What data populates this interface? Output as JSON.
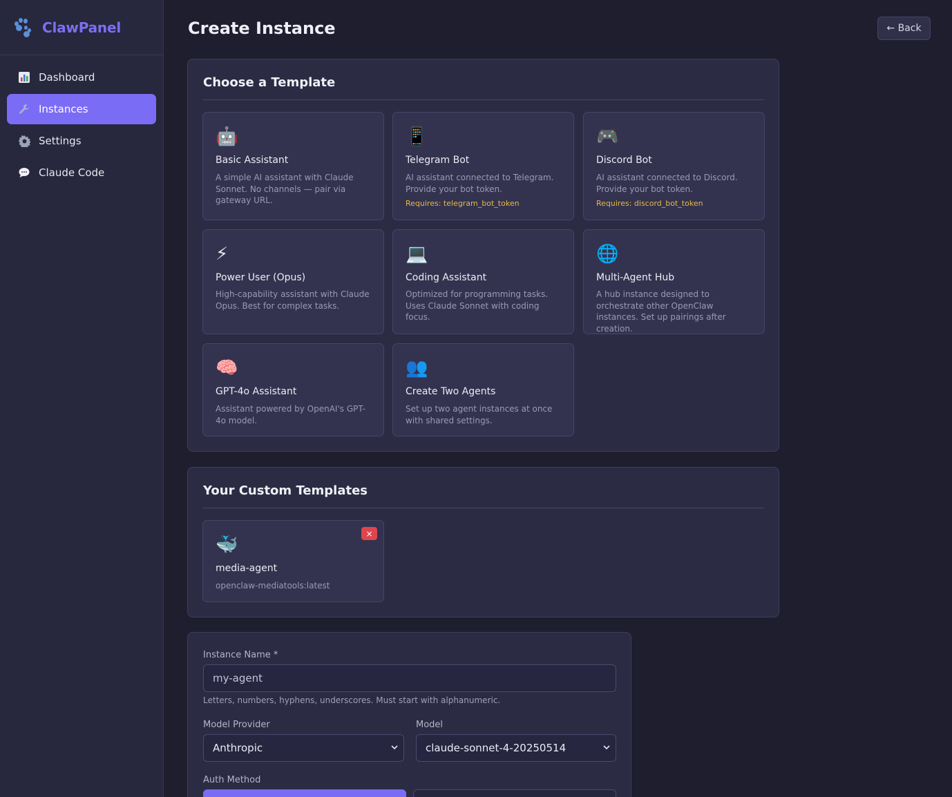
{
  "app": {
    "name": "ClawPanel"
  },
  "sidebar": {
    "items": [
      {
        "label": "Dashboard",
        "icon": "bar-chart-icon",
        "active": false
      },
      {
        "label": "Instances",
        "icon": "wrench-icon",
        "active": true
      },
      {
        "label": "Settings",
        "icon": "gear-icon",
        "active": false
      },
      {
        "label": "Claude Code",
        "icon": "speech-bubble-icon",
        "active": false
      }
    ]
  },
  "header": {
    "title": "Create Instance",
    "back_label": "← Back"
  },
  "templates": {
    "heading": "Choose a Template",
    "cards": [
      {
        "emoji": "🤖",
        "icon": "robot-icon",
        "title": "Basic Assistant",
        "desc": "A simple AI assistant with Claude Sonnet. No channels — pair via gateway URL.",
        "requires": ""
      },
      {
        "emoji": "📱",
        "icon": "phone-icon",
        "title": "Telegram Bot",
        "desc": "AI assistant connected to Telegram. Provide your bot token.",
        "requires": "Requires: telegram_bot_token"
      },
      {
        "emoji": "🎮",
        "icon": "game-controller-icon",
        "title": "Discord Bot",
        "desc": "AI assistant connected to Discord. Provide your bot token.",
        "requires": "Requires: discord_bot_token"
      },
      {
        "emoji": "⚡",
        "icon": "lightning-icon",
        "title": "Power User (Opus)",
        "desc": "High-capability assistant with Claude Opus. Best for complex tasks.",
        "requires": ""
      },
      {
        "emoji": "💻",
        "icon": "laptop-icon",
        "title": "Coding Assistant",
        "desc": "Optimized for programming tasks. Uses Claude Sonnet with coding focus.",
        "requires": ""
      },
      {
        "emoji": "🌐",
        "icon": "globe-icon",
        "title": "Multi-Agent Hub",
        "desc": "A hub instance designed to orchestrate other OpenClaw instances. Set up pairings after creation.",
        "requires": ""
      },
      {
        "emoji": "🧠",
        "icon": "brain-icon",
        "title": "GPT-4o Assistant",
        "desc": "Assistant powered by OpenAI's GPT-4o model.",
        "requires": ""
      },
      {
        "emoji": "👥",
        "icon": "two-people-icon",
        "title": "Create Two Agents",
        "desc": "Set up two agent instances at once with shared settings.",
        "requires": ""
      }
    ]
  },
  "custom_templates": {
    "heading": "Your Custom Templates",
    "cards": [
      {
        "emoji": "🐳",
        "icon": "whale-icon",
        "title": "media-agent",
        "desc": "openclaw-mediatools:latest",
        "delete_label": "×"
      }
    ]
  },
  "form": {
    "name_label": "Instance Name *",
    "name_placeholder": "my-agent",
    "name_hint": "Letters, numbers, hyphens, underscores. Must start with alphanumeric.",
    "provider_label": "Model Provider",
    "provider_value": "Anthropic",
    "model_label": "Model",
    "model_value": "claude-sonnet-4-20250514",
    "auth_label": "Auth Method"
  },
  "colors": {
    "accent": "#7b6cf6",
    "background": "#1e1e2e",
    "panel": "#2b2b43",
    "warning": "#e8b84a",
    "danger": "#e0454d"
  }
}
